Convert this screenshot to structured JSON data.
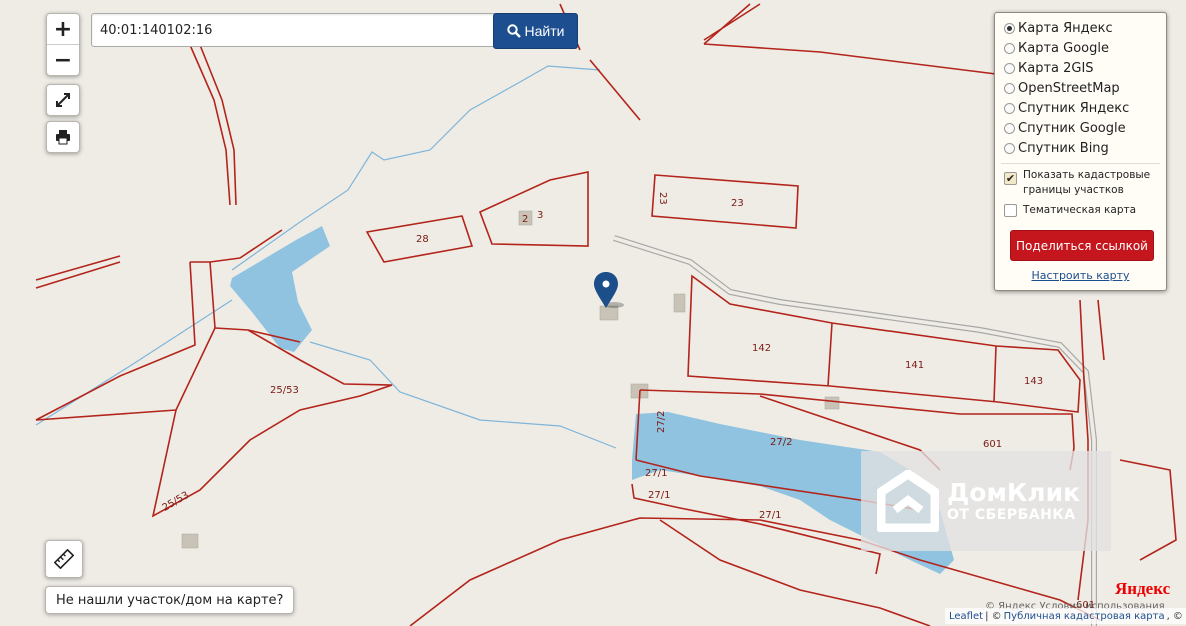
{
  "search": {
    "value": "40:01:140102:16",
    "button_label": "Найти"
  },
  "zoom": {
    "in_label": "+",
    "out_label": "−"
  },
  "layers": {
    "base_maps": [
      {
        "label": "Карта Яндекс",
        "selected": true
      },
      {
        "label": "Карта Google",
        "selected": false
      },
      {
        "label": "Карта 2GIS",
        "selected": false
      },
      {
        "label": "OpenStreetMap",
        "selected": false
      },
      {
        "label": "Спутник Яндекс",
        "selected": false
      },
      {
        "label": "Спутник Google",
        "selected": false
      },
      {
        "label": "Спутник Bing",
        "selected": false
      }
    ],
    "options": [
      {
        "label": "Показать кадастровые границы участков",
        "checked": true
      },
      {
        "label": "Тематическая карта",
        "checked": false
      }
    ],
    "share_label": "Поделиться ссылкой",
    "configure_label": "Настроить карту"
  },
  "not_found_label": "Не нашли участок/дом на карте?",
  "plots": [
    {
      "label": "3"
    },
    {
      "label": "2"
    },
    {
      "label": "28"
    },
    {
      "label": "23"
    },
    {
      "label": "23"
    },
    {
      "label": "142"
    },
    {
      "label": "141"
    },
    {
      "label": "143"
    },
    {
      "label": "601"
    },
    {
      "label": "25/53"
    },
    {
      "label": "25/53"
    },
    {
      "label": "27/2"
    },
    {
      "label": "27/2"
    },
    {
      "label": "27/1"
    },
    {
      "label": "27/1"
    },
    {
      "label": "27/1"
    },
    {
      "label": "601"
    }
  ],
  "watermark": {
    "title": "ДомКлик",
    "subtitle": "ОТ СБЕРБАНКА"
  },
  "yandex": {
    "logo": "Яндекс",
    "terms": "© Яндекс  Условия использования"
  },
  "attribution": {
    "leaflet": "Leaflet",
    "separator": " | © ",
    "cadastre": "Публичная кадастровая карта",
    "suffix": ", ©"
  },
  "colors": {
    "boundary": "#b3241b",
    "water": "#8fc3e0",
    "stream": "#7fb5d9",
    "road": "#a8a8a8",
    "search_button": "#1d4e8f",
    "share_button": "#c4161c",
    "marker": "#1c4e8a"
  },
  "icons": {
    "fullscreen": "fullscreen-icon",
    "print": "print-icon",
    "ruler": "ruler-icon",
    "search": "search-icon",
    "marker": "location-marker-icon"
  }
}
